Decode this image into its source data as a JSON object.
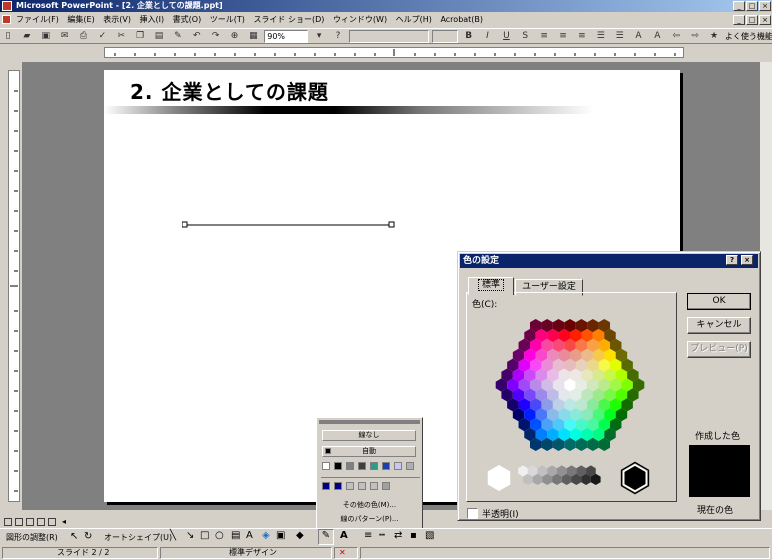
{
  "window": {
    "title": "Microsoft PowerPoint - [2. 企業としての課題.ppt]"
  },
  "menu": {
    "items": [
      "ファイル(F)",
      "編集(E)",
      "表示(V)",
      "挿入(I)",
      "書式(O)",
      "ツール(T)",
      "スライド ショー(D)",
      "ウィンドウ(W)",
      "ヘルプ(H)",
      "Acrobat(B)"
    ]
  },
  "toolbar": {
    "zoom": "90%",
    "frequent_label": "よく使う機能(O)"
  },
  "slide": {
    "title": "2. 企業としての課題"
  },
  "color_dialog": {
    "title": "色の設定",
    "help_label": "?",
    "close_label": "×",
    "tab_standard": "標準",
    "tab_custom": "ユーザー設定",
    "colors_label": "色(C):",
    "ok_label": "OK",
    "cancel_label": "キャンセル",
    "preview_label": "プレビュー(P)",
    "new_color_label": "作成した色",
    "current_color_label": "現在の色",
    "translucent_label": "半透明(I)",
    "selected_color": "#000000"
  },
  "line_color_popup": {
    "no_line_label": "線なし",
    "auto_label": "自動",
    "more_colors_label": "その他の色(M)...",
    "patterns_label": "線のパターン(P)...",
    "scheme_colors": [
      "#ffffff",
      "#000000",
      "#808080",
      "#404040",
      "#2e9b8a",
      "#1f3fa8",
      "#c8c8f0",
      "#b0b0b0"
    ],
    "recent_colors": [
      "#000080",
      "#000080",
      "#c0c0c0",
      "#c0c0c0",
      "#c0c0c0",
      "#a0a0a0"
    ]
  },
  "drawing_toolbar": {
    "draw_menu": "図形の調整(R)",
    "autoshapes_menu": "オートシェイプ(U)"
  },
  "status": {
    "slide_indicator": "スライド 2 / 2",
    "design": "標準デザイン"
  }
}
